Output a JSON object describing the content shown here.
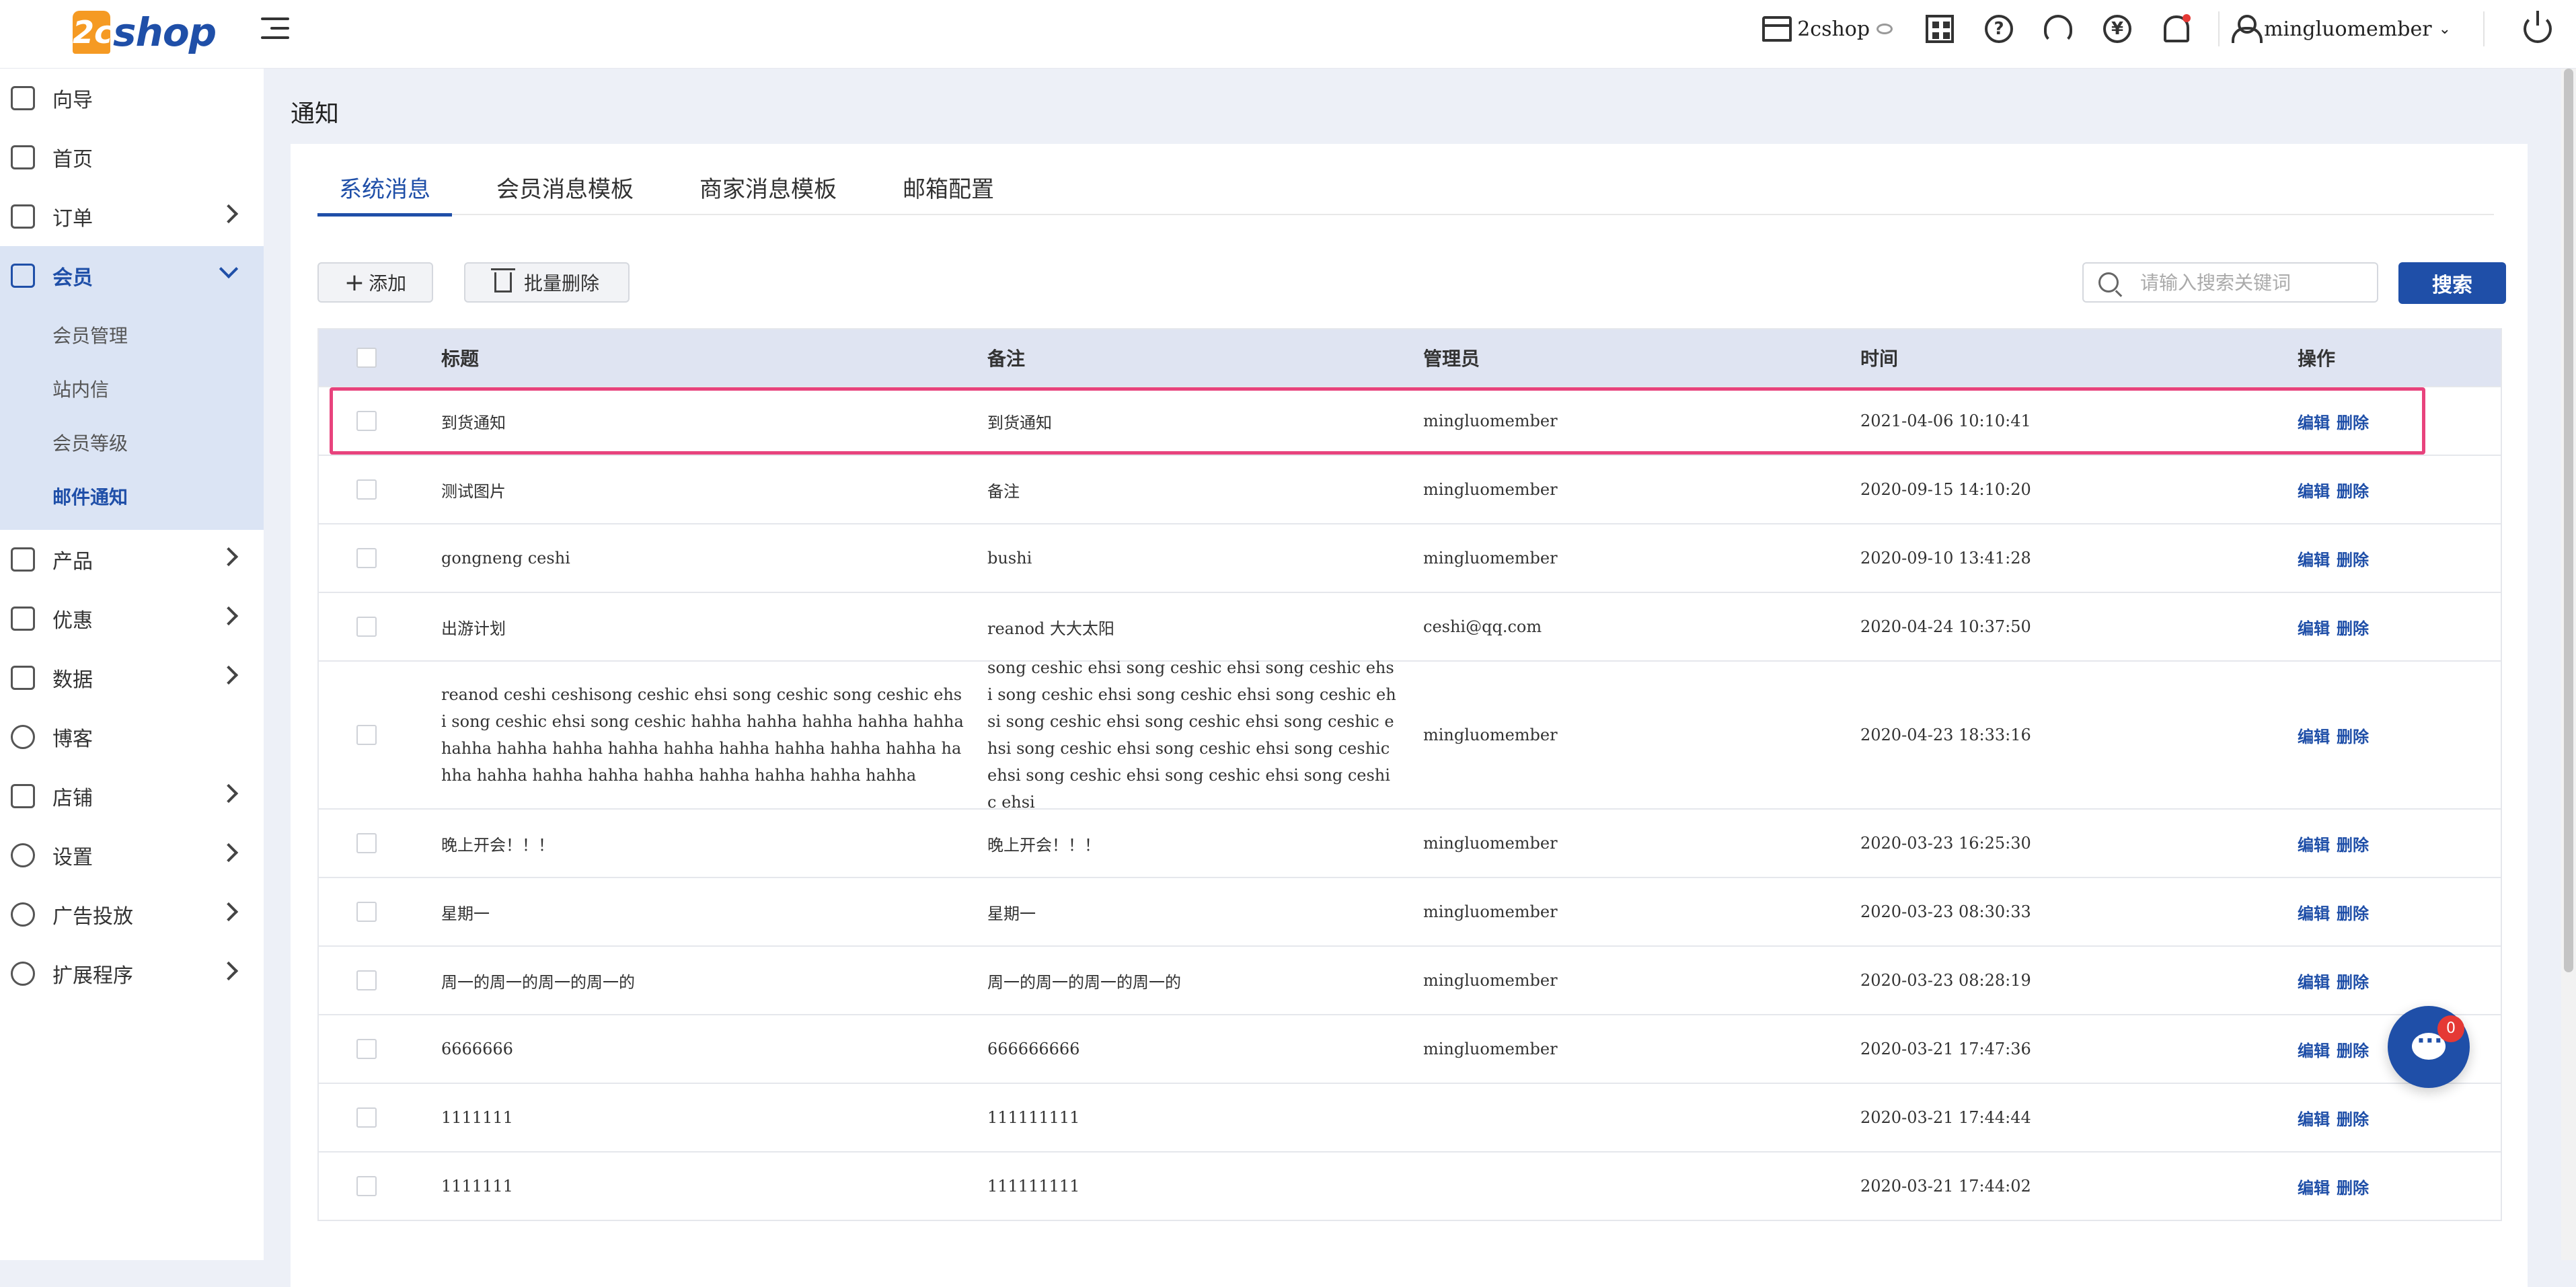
{
  "header": {
    "logo_prefix": "2c",
    "logo_text": "shop",
    "shop_name": "2cshop",
    "user_name": "mingluomember",
    "icons": [
      "store-icon",
      "eye-icon",
      "qr-code-icon",
      "help-icon",
      "headset-icon",
      "yuan-icon",
      "bell-icon",
      "user-icon",
      "power-icon"
    ],
    "accent_color": "#1f4fa8"
  },
  "sidebar": {
    "items": [
      {
        "label": "向导",
        "icon": "signpost-icon"
      },
      {
        "label": "首页",
        "icon": "home-icon"
      },
      {
        "label": "订单",
        "icon": "order-icon"
      },
      {
        "label": "会员",
        "icon": "member-icon"
      },
      {
        "label": "产品",
        "icon": "product-icon"
      },
      {
        "label": "优惠",
        "icon": "tag-icon"
      },
      {
        "label": "数据",
        "icon": "chart-icon"
      },
      {
        "label": "博客",
        "icon": "blog-icon"
      },
      {
        "label": "店铺",
        "icon": "shop-icon"
      },
      {
        "label": "设置",
        "icon": "gear-icon"
      },
      {
        "label": "广告投放",
        "icon": "target-icon"
      },
      {
        "label": "扩展程序",
        "icon": "extension-icon"
      }
    ],
    "member_sub": [
      "会员管理",
      "站内信",
      "会员等级",
      "邮件通知"
    ]
  },
  "main": {
    "page_title": "通知",
    "tabs": [
      "系统消息",
      "会员消息模板",
      "商家消息模板",
      "邮箱配置"
    ],
    "toolbar": {
      "add_label": "添加",
      "batch_delete_label": "批量删除",
      "search_placeholder": "请输入搜索关键词",
      "search_label": "搜索"
    },
    "table": {
      "columns": [
        "标题",
        "备注",
        "管理员",
        "时间",
        "操作"
      ],
      "edit_label": "编辑",
      "delete_label": "删除",
      "rows": [
        {
          "title": "到货通知",
          "note": "到货通知",
          "admin": "mingluomember",
          "time": "2021-04-06 10:10:41"
        },
        {
          "title": "测试图片",
          "note": "备注",
          "admin": "mingluomember",
          "time": "2020-09-15 14:10:20"
        },
        {
          "title": "gongneng ceshi",
          "note": "bushi",
          "admin": "mingluomember",
          "time": "2020-09-10 13:41:28"
        },
        {
          "title": "出游计划",
          "note": "reanod 大大太阳",
          "admin": "ceshi@qq.com",
          "time": "2020-04-24 10:37:50"
        },
        {
          "title": "reanod ceshi ceshisong ceshic ehsi song ceshic song ceshic ehsi song ceshic ehsi song ceshic hahha hahha hahha hahha hahha hahha hahha hahha hahha hahha hahha hahha hahha hahha hahha hahha hahha hahha hahha hahha hahha hahha hahha",
          "note": "song ceshic ehsi song ceshic ehsi song ceshic ehsi song ceshic ehsi song ceshic ehsi song ceshic ehsi song ceshic ehsi song ceshic ehsi song ceshic ehsi song ceshic ehsi song ceshic ehsi song ceshic ehsi song ceshic ehsi song ceshic ehsi song ceshic ehsi",
          "admin": "mingluomember",
          "time": "2020-04-23 18:33:16"
        },
        {
          "title": "晚上开会！！！",
          "note": "晚上开会！！！",
          "admin": "mingluomember",
          "time": "2020-03-23 16:25:30"
        },
        {
          "title": "星期一",
          "note": "星期一",
          "admin": "mingluomember",
          "time": "2020-03-23 08:30:33"
        },
        {
          "title": "周一的周一的周一的周一的",
          "note": "周一的周一的周一的周一的",
          "admin": "mingluomember",
          "time": "2020-03-23 08:28:19"
        },
        {
          "title": "6666666",
          "note": "666666666",
          "admin": "mingluomember",
          "time": "2020-03-21 17:47:36"
        },
        {
          "title": "1111111",
          "note": "111111111",
          "admin": "",
          "time": "2020-03-21 17:44:44"
        },
        {
          "title": "1111111",
          "note": "111111111",
          "admin": "",
          "time": "2020-03-21 17:44:02"
        }
      ]
    }
  },
  "chat": {
    "badge_count": "0"
  }
}
